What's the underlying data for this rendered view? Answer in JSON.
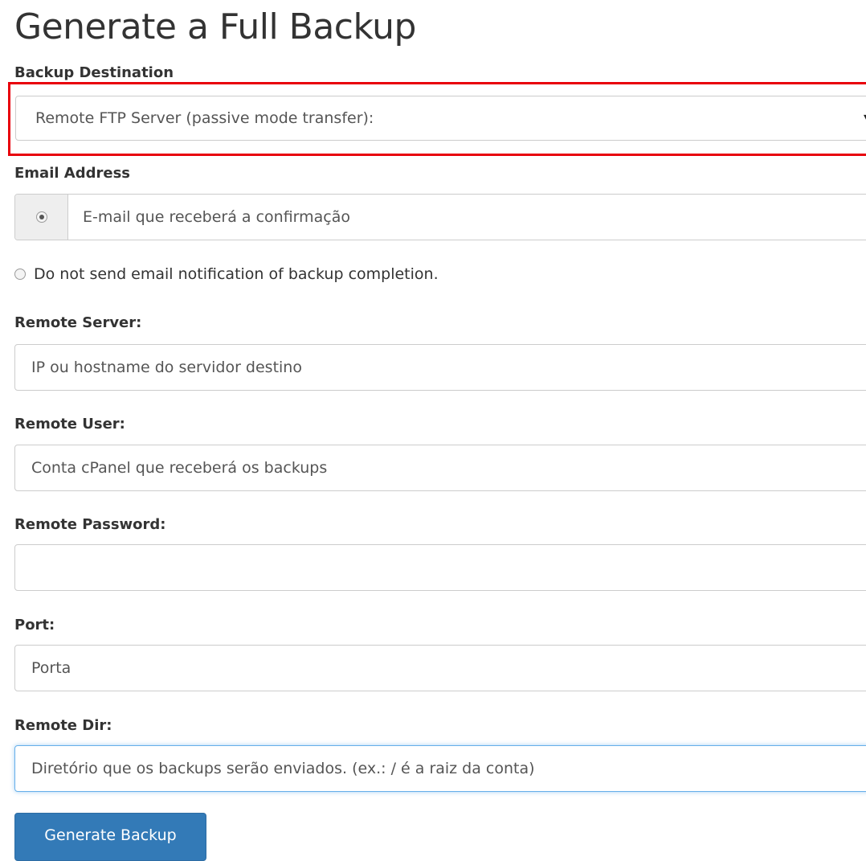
{
  "page_title": "Generate a Full Backup",
  "backup_destination": {
    "label": "Backup Destination",
    "selected": "Remote FTP Server (passive mode transfer):",
    "arrow": "▾"
  },
  "email": {
    "label": "Email Address",
    "placeholder": "E-mail que receberá a confirmação",
    "no_email_option": "Do not send email notification of backup completion."
  },
  "remote_server": {
    "label": "Remote Server:",
    "placeholder": "IP ou hostname do servidor destino"
  },
  "remote_user": {
    "label": "Remote User:",
    "placeholder": "Conta cPanel que receberá os backups"
  },
  "remote_password": {
    "label": "Remote Password:",
    "placeholder": ""
  },
  "port": {
    "label": "Port:",
    "placeholder": "Porta"
  },
  "remote_dir": {
    "label": "Remote Dir:",
    "placeholder": "Diretório que os backups serão enviados. (ex.: / é a raiz da conta)"
  },
  "submit": {
    "label": "Generate Backup"
  },
  "colors": {
    "highlight": "#e8000b",
    "primary": "#337ab7",
    "focus": "#66afe9"
  }
}
